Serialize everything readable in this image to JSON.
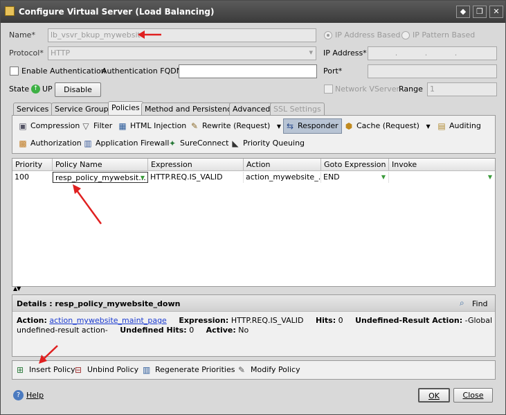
{
  "window": {
    "title": "Configure Virtual Server (Load Balancing)"
  },
  "form": {
    "name_label": "Name*",
    "name_value": "lb_vsvr_bkup_mywebsite",
    "protocol_label": "Protocol*",
    "protocol_value": "HTTP",
    "enable_auth_label": "Enable Authentication",
    "auth_fqdn_label": "Authentication FQDN",
    "auth_fqdn_value": "",
    "state_label": "State",
    "state_value": "UP",
    "disable_button": "Disable",
    "ip_based_label": "IP Address Based",
    "ip_pattern_label": "IP Pattern Based",
    "ip_address_label": "IP Address*",
    "ip_address_value": ". . .",
    "port_label": "Port*",
    "port_value": "",
    "network_vserver_label": "Network VServer",
    "range_label": "Range",
    "range_value": "1"
  },
  "tabs": [
    {
      "label": "Services"
    },
    {
      "label": "Service Groups"
    },
    {
      "label": "Policies"
    },
    {
      "label": "Method and Persistence"
    },
    {
      "label": "Advanced"
    },
    {
      "label": "SSL Settings"
    }
  ],
  "toolbar": {
    "row1": [
      {
        "label": "Compression",
        "icon": "compression-icon"
      },
      {
        "label": "Filter",
        "icon": "filter-icon"
      },
      {
        "label": "HTML Injection",
        "icon": "html-injection-icon"
      },
      {
        "label": "Rewrite (Request)",
        "icon": "rewrite-icon"
      },
      {
        "label": "Responder",
        "icon": "responder-icon"
      },
      {
        "label": "Cache (Request)",
        "icon": "cache-icon"
      },
      {
        "label": "Auditing",
        "icon": "auditing-icon"
      }
    ],
    "row2": [
      {
        "label": "Authorization",
        "icon": "authorization-icon"
      },
      {
        "label": "Application Firewall",
        "icon": "firewall-icon"
      },
      {
        "label": "SureConnect",
        "icon": "sureconnect-icon"
      },
      {
        "label": "Priority Queuing",
        "icon": "priority-queuing-icon"
      }
    ]
  },
  "table": {
    "columns": [
      "Priority",
      "Policy Name",
      "Expression",
      "Action",
      "Goto Expression",
      "Invoke"
    ],
    "rows": [
      {
        "priority": "100",
        "policy_name": "resp_policy_mywebsit...",
        "expression": "HTTP.REQ.IS_VALID",
        "action": "action_mywebsite_...",
        "goto": "END",
        "invoke": ""
      }
    ]
  },
  "details": {
    "title": "Details : resp_policy_mywebsite_down",
    "find_label": "Find",
    "action_label": "Action:",
    "action_value": "action_mywebsite_maint_page",
    "expression_label": "Expression:",
    "expression_value": "HTTP.REQ.IS_VALID",
    "hits_label": "Hits:",
    "hits_value": "0",
    "undef_action_label": "Undefined-Result Action:",
    "undef_action_value": "-Global",
    "undef_action_cont": "undefined-result action-",
    "undef_hits_label": "Undefined Hits:",
    "undef_hits_value": "0",
    "active_label": "Active:",
    "active_value": "No"
  },
  "bottom_actions": {
    "insert": "Insert Policy",
    "unbind": "Unbind Policy",
    "regenerate": "Regenerate Priorities",
    "modify": "Modify Policy"
  },
  "footer": {
    "help": "Help",
    "ok": "OK",
    "close": "Close"
  },
  "colors": {
    "arrow": "#e02020",
    "status_up": "#3cb043",
    "link": "#1a3ad0"
  }
}
